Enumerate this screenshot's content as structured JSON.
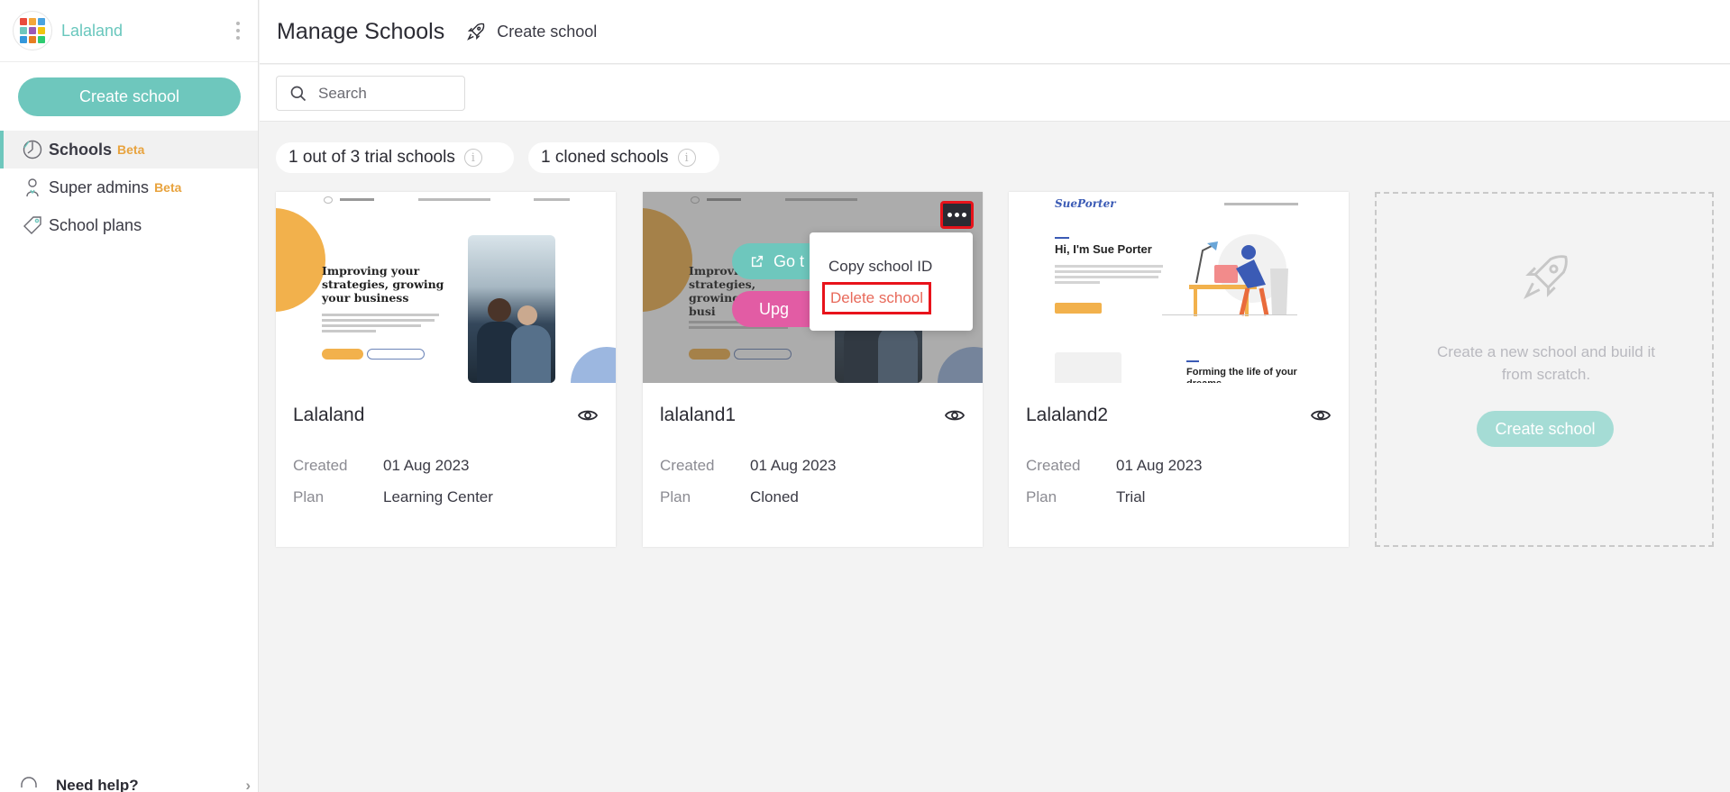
{
  "brand": {
    "name": "Lalaland"
  },
  "sidebar": {
    "create_button": "Create school",
    "items": [
      {
        "label": "Schools",
        "badge": "Beta",
        "active": true,
        "icon": "schools-icon"
      },
      {
        "label": "Super admins",
        "badge": "Beta",
        "active": false,
        "icon": "super-admins-icon"
      },
      {
        "label": "School plans",
        "badge": "",
        "active": false,
        "icon": "tag-icon"
      }
    ],
    "help_label": "Need help?"
  },
  "header": {
    "title": "Manage Schools",
    "create_label": "Create school"
  },
  "search": {
    "placeholder": "Search"
  },
  "stats": {
    "trial": "1 out of 3 trial schools",
    "cloned": "1 cloned schools"
  },
  "schools": [
    {
      "name": "Lalaland",
      "created_label": "Created",
      "created": "01 Aug 2023",
      "plan_label": "Plan",
      "plan": "Learning Center"
    },
    {
      "name": "lalaland1",
      "created_label": "Created",
      "created": "01 Aug 2023",
      "plan_label": "Plan",
      "plan": "Cloned"
    },
    {
      "name": "Lalaland2",
      "created_label": "Created",
      "created": "01 Aug 2023",
      "plan_label": "Plan",
      "plan": "Trial"
    }
  ],
  "thumb1": {
    "hero_title": "Improving your strategies, growing your business"
  },
  "thumb2": {
    "goto_label": "Go t",
    "upgrade_label": "Upg",
    "hero_title": "Improvi strategies, growing your busi"
  },
  "thumb3": {
    "logo": "SuePorter",
    "hero_title": "Hi, I'm Sue Porter",
    "forming": "Forming the life of your dreams"
  },
  "context_menu": {
    "copy_id": "Copy school ID",
    "delete": "Delete school"
  },
  "new_school": {
    "text": "Create a new school and build it from scratch.",
    "button": "Create school"
  },
  "colors": {
    "accent": "#6ec7bd",
    "beta": "#e8a33e",
    "upgrade": "#e25ca4",
    "highlight": "#e8131b"
  }
}
